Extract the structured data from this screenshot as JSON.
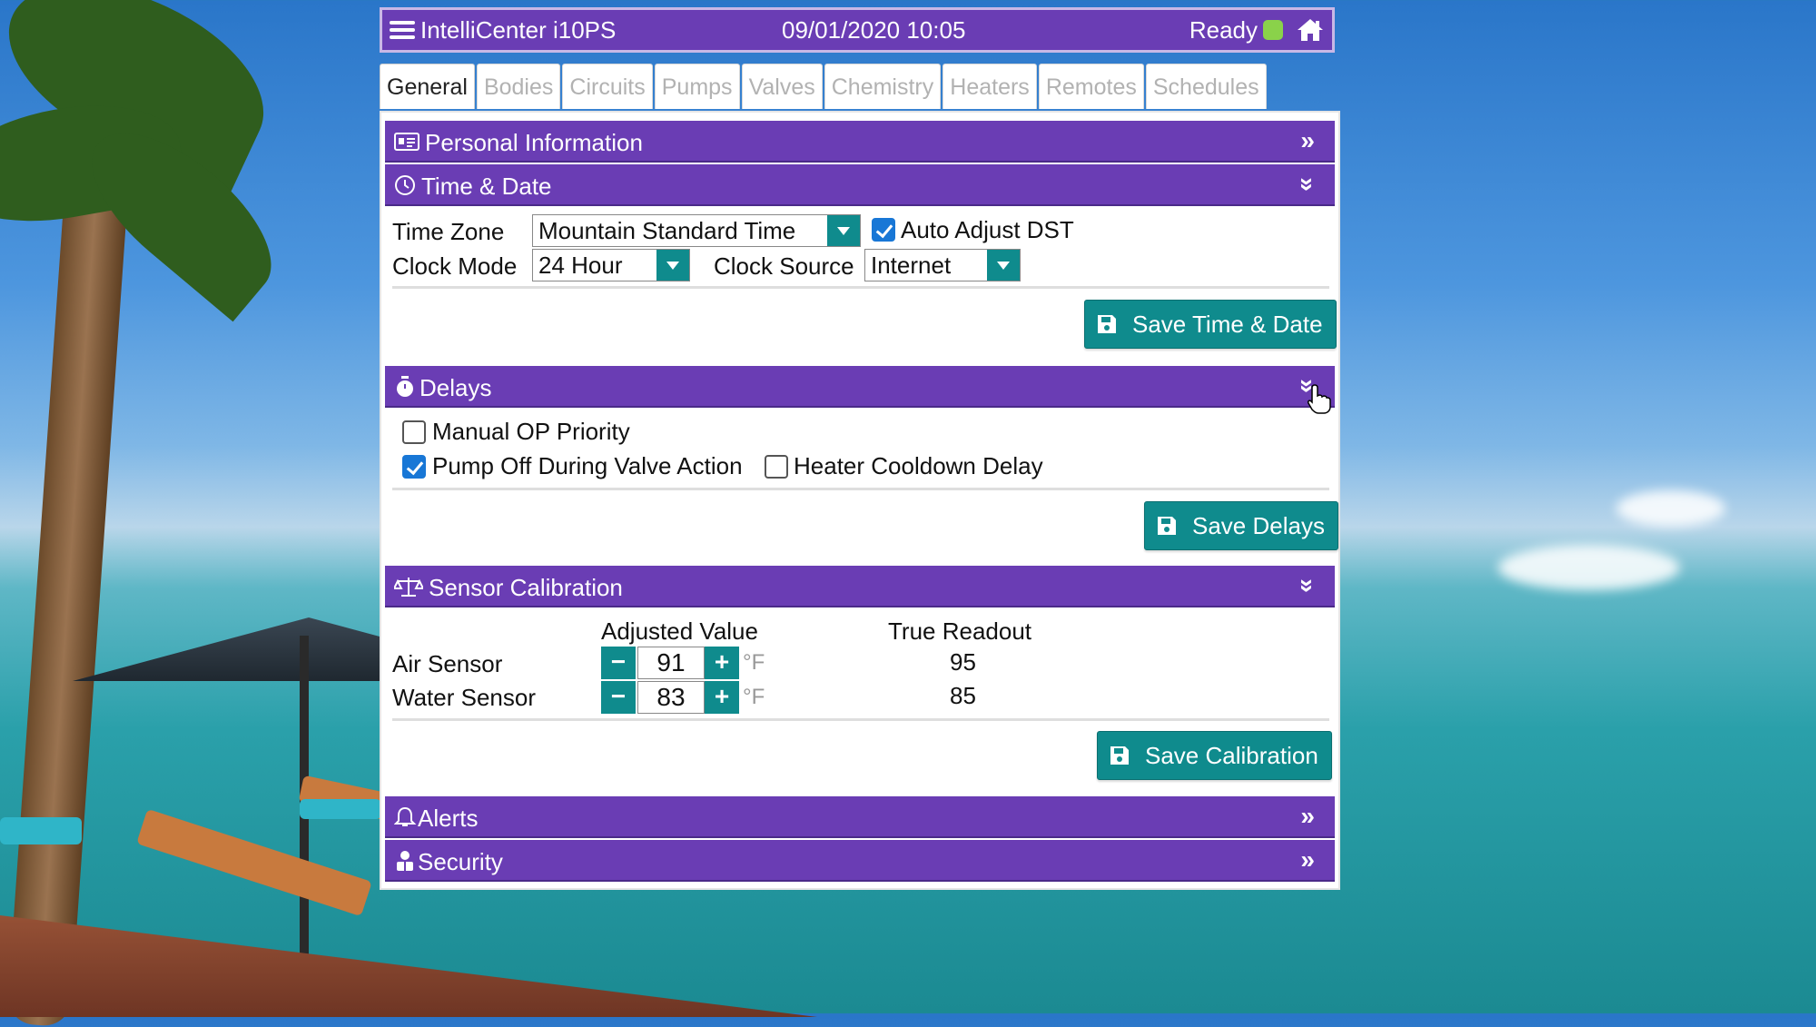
{
  "header": {
    "title": "IntelliCenter i10PS",
    "datetime": "09/01/2020 10:05",
    "status": "Ready"
  },
  "tabs": [
    {
      "label": "General",
      "active": true
    },
    {
      "label": "Bodies"
    },
    {
      "label": "Circuits"
    },
    {
      "label": "Pumps"
    },
    {
      "label": "Valves"
    },
    {
      "label": "Chemistry"
    },
    {
      "label": "Heaters"
    },
    {
      "label": "Remotes"
    },
    {
      "label": "Schedules"
    }
  ],
  "sections": {
    "personal": {
      "label": "Personal Information",
      "icon": "id-card-icon"
    },
    "time": {
      "label": "Time & Date",
      "icon": "clock-icon",
      "time_zone_label": "Time Zone",
      "time_zone_value": "Mountain Standard Time",
      "auto_dst_label": "Auto Adjust DST",
      "auto_dst_checked": true,
      "clock_mode_label": "Clock Mode",
      "clock_mode_value": "24 Hour",
      "clock_source_label": "Clock Source",
      "clock_source_value": "Internet",
      "save_label": "Save Time & Date"
    },
    "delays": {
      "label": "Delays",
      "icon": "stopwatch-icon",
      "manual_op_label": "Manual OP Priority",
      "manual_op_checked": false,
      "pump_off_label": "Pump Off During Valve Action",
      "pump_off_checked": true,
      "heater_cooldown_label": "Heater Cooldown Delay",
      "heater_cooldown_checked": false,
      "save_label": "Save Delays"
    },
    "calibration": {
      "label": "Sensor Calibration",
      "icon": "balance-scale-icon",
      "col_adjusted": "Adjusted Value",
      "col_true": "True Readout",
      "air_label": "Air Sensor",
      "air_value": "91",
      "air_true": "95",
      "water_label": "Water Sensor",
      "water_value": "83",
      "water_true": "85",
      "unit": "°F",
      "minus": "−",
      "plus": "+",
      "save_label": "Save Calibration"
    },
    "alerts": {
      "label": "Alerts",
      "icon": "bell-icon"
    },
    "security": {
      "label": "Security",
      "icon": "users-icon"
    }
  },
  "colors": {
    "header_purple": "#6a3db4",
    "accent_teal": "#0f8b8d",
    "status_led": "#8ad24a",
    "checkbox_blue": "#1877d6"
  }
}
